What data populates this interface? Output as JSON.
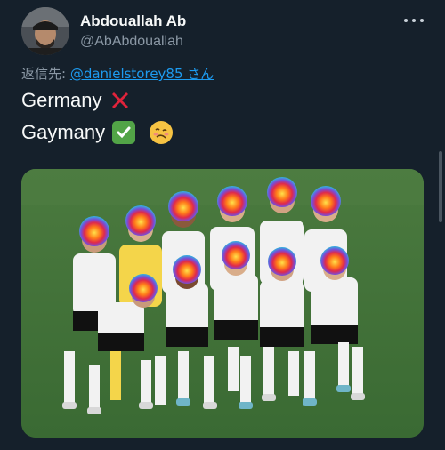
{
  "tweet": {
    "display_name": "Abdouallah Ab",
    "handle": "@AbAbdouallah",
    "reply_prefix": "返信先: ",
    "reply_to": "@danielstorey85",
    "reply_suffix": " さん",
    "lines": [
      "Germany",
      "Gaymany"
    ]
  },
  "icons": {
    "more": "more-dots-icon",
    "cross": "red-cross-mark-icon",
    "check": "green-check-mark-icon",
    "face": "woozy-face-icon"
  },
  "media": {
    "subject": "team-photo"
  },
  "colors": {
    "background": "#15202b",
    "link": "#1d9bf0",
    "secondary_text": "#8b98a5",
    "pitch": "#3b6b35"
  }
}
